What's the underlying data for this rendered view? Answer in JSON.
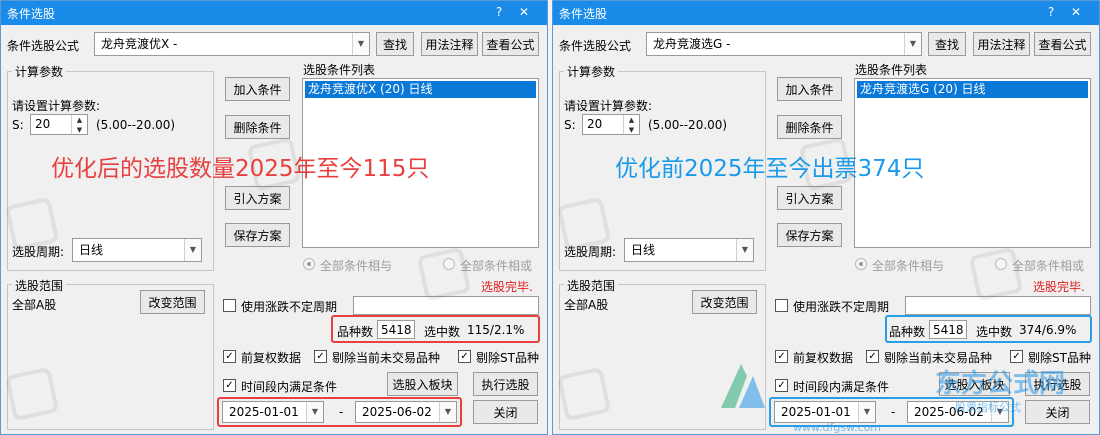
{
  "colors": {
    "titlebar": "#1a8be8",
    "selection": "#0a78d7",
    "left_annotation": "#e84040",
    "right_annotation": "#1a9ae8",
    "left_box": "#e84040",
    "right_box": "#2a9de8",
    "status_red": "#e02020"
  },
  "watermark": {
    "text": "江T公式网"
  },
  "left": {
    "title": "条件选股",
    "formula_label": "条件选股公式",
    "formula_value": "龙舟竞渡优X  -",
    "find_btn": "查找",
    "usage_btn": "用法注释",
    "view_btn": "查看公式",
    "calc_group_title": "计算参数",
    "calc_prompt": "请设置计算参数:",
    "param_label": "S:",
    "param_value": "20",
    "param_range": "(5.00--20.00)",
    "period_label": "选股周期:",
    "period_value": "日线",
    "list_title": "选股条件列表",
    "list_items": [
      "龙舟竞渡优X (20) 日线"
    ],
    "add_btn": "加入条件",
    "del_btn": "删除条件",
    "import_btn": "引入方案",
    "save_btn": "保存方案",
    "radio_and": "全部条件相与",
    "radio_or": "全部条件相或",
    "range_group_title": "选股范围",
    "range_value": "全部A股",
    "change_range_btn": "改变范围",
    "status": "选股完毕.",
    "use_irregular": "使用涨跌不定周期",
    "count_label": "品种数",
    "count_value": "5418",
    "selected_label": "选中数",
    "selected_value": "115/2.1%",
    "chk_prev": "前复权数据",
    "chk_exclude_untrade": "剔除当前未交易品种",
    "chk_exclude_st": "剔除ST品种",
    "chk_timerange": "时间段内满足条件",
    "to_block_btn": "选股入板块",
    "exec_btn": "执行选股",
    "date_from": "2025-01-01",
    "date_sep": "-",
    "date_to": "2025-06-02",
    "close_btn": "关闭",
    "annotation": "优化后的选股数量2025年至今115只"
  },
  "right": {
    "title": "条件选股",
    "formula_label": "条件选股公式",
    "formula_value": "龙舟竞渡选G  -",
    "find_btn": "查找",
    "usage_btn": "用法注释",
    "view_btn": "查看公式",
    "calc_group_title": "计算参数",
    "calc_prompt": "请设置计算参数:",
    "param_label": "S:",
    "param_value": "20",
    "param_range": "(5.00--20.00)",
    "period_label": "选股周期:",
    "period_value": "日线",
    "list_title": "选股条件列表",
    "list_items": [
      "龙舟竞渡选G (20) 日线"
    ],
    "add_btn": "加入条件",
    "del_btn": "删除条件",
    "import_btn": "引入方案",
    "save_btn": "保存方案",
    "radio_and": "全部条件相与",
    "radio_or": "全部条件相或",
    "range_group_title": "选股范围",
    "range_value": "全部A股",
    "change_range_btn": "改变范围",
    "status": "选股完毕.",
    "use_irregular": "使用涨跌不定周期",
    "count_label": "品种数",
    "count_value": "5418",
    "selected_label": "选中数",
    "selected_value": "374/6.9%",
    "chk_prev": "前复权数据",
    "chk_exclude_untrade": "剔除当前未交易品种",
    "chk_exclude_st": "剔除ST品种",
    "chk_timerange": "时间段内满足条件",
    "to_block_btn": "选股入板块",
    "exec_btn": "执行选股",
    "date_from": "2025-01-01",
    "date_sep": "-",
    "date_to": "2025-06-02",
    "close_btn": "关闭",
    "annotation": "优化前2025年至今出票374只",
    "brand_name": "东方公式网",
    "brand_site": "www.dfgsw.com",
    "brand_tagline": "股票指标公式"
  }
}
